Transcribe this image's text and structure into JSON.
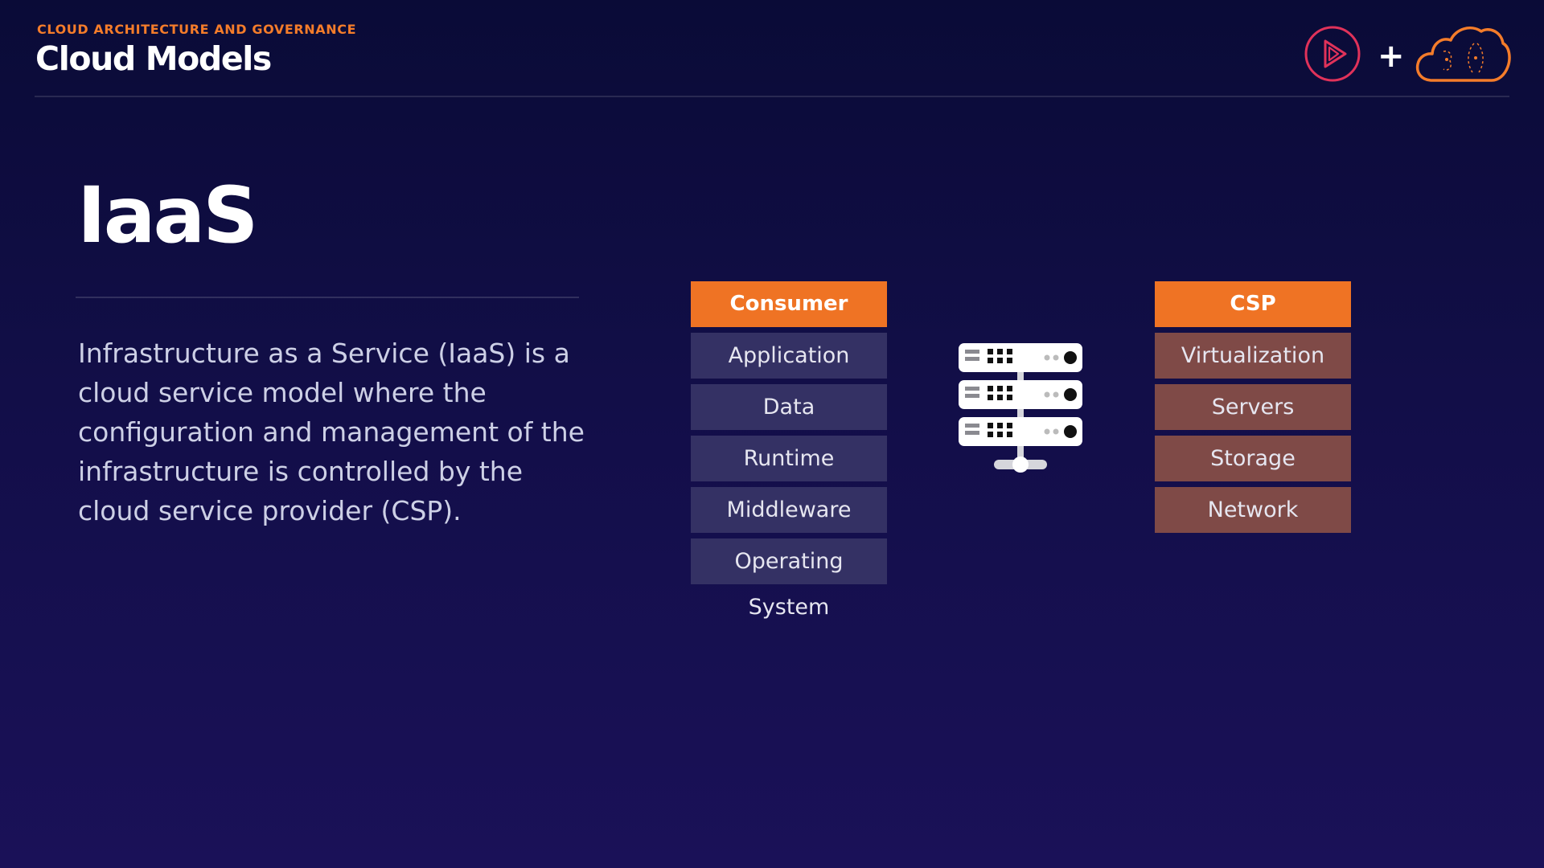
{
  "header": {
    "kicker": "CLOUD ARCHITECTURE AND GOVERNANCE",
    "title": "Cloud Models",
    "kicker_color": "#f47c2a",
    "logos": [
      {
        "icon": "play-logo-icon",
        "color": "#e0325a"
      },
      {
        "icon": "plus-icon",
        "text": "+"
      },
      {
        "icon": "cloud-logo-icon",
        "color": "#f47c2a"
      }
    ]
  },
  "main": {
    "title": "IaaS",
    "description": "Infrastructure as a Service (IaaS) is a cloud service model where the configuration and management of the infrastructure is controlled by the cloud service provider (CSP)."
  },
  "consumer": {
    "header": "Consumer",
    "header_color": "#ef7324",
    "item_color": "#343164",
    "items": [
      "Application",
      "Data",
      "Runtime",
      "Middleware",
      "Operating System"
    ]
  },
  "csp": {
    "header": "CSP",
    "header_color": "#ef7324",
    "item_color": "#7f4a47",
    "items": [
      "Virtualization",
      "Servers",
      "Storage",
      "Network"
    ]
  },
  "diagram": {
    "center_icon": "server-rack-icon"
  }
}
